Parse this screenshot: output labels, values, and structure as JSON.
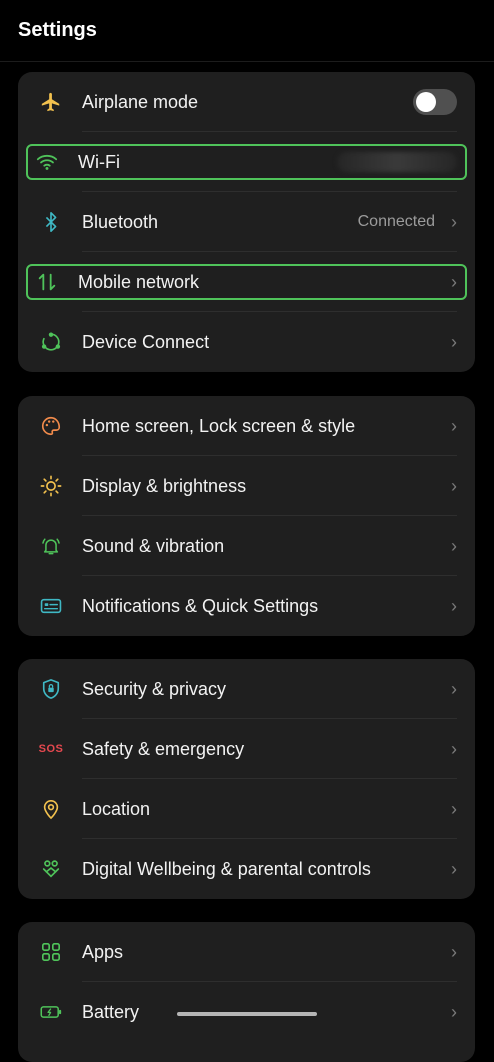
{
  "header": {
    "title": "Settings"
  },
  "colors": {
    "accent_green": "#4fc35a",
    "background": "#000000",
    "card": "#1f1f1f"
  },
  "groups": [
    {
      "items": [
        {
          "label": "Airplane mode",
          "icon": "airplane-icon",
          "toggle": false
        },
        {
          "label": "Wi-Fi",
          "icon": "wifi-icon",
          "highlighted": true
        },
        {
          "label": "Bluetooth",
          "icon": "bluetooth-icon",
          "status": "Connected"
        },
        {
          "label": "Mobile network",
          "icon": "mobile-network-icon",
          "highlighted": true
        },
        {
          "label": "Device Connect",
          "icon": "device-connect-icon"
        }
      ]
    },
    {
      "items": [
        {
          "label": "Home screen, Lock screen & style",
          "icon": "palette-icon"
        },
        {
          "label": "Display & brightness",
          "icon": "sun-icon"
        },
        {
          "label": "Sound & vibration",
          "icon": "bell-icon"
        },
        {
          "label": "Notifications & Quick Settings",
          "icon": "notification-icon"
        }
      ]
    },
    {
      "items": [
        {
          "label": "Security & privacy",
          "icon": "shield-icon"
        },
        {
          "label": "Safety & emergency",
          "icon": "sos-icon",
          "icon_text": "SOS"
        },
        {
          "label": "Location",
          "icon": "location-pin-icon"
        },
        {
          "label": "Digital Wellbeing & parental controls",
          "icon": "wellbeing-icon"
        }
      ]
    },
    {
      "items": [
        {
          "label": "Apps",
          "icon": "apps-grid-icon"
        },
        {
          "label": "Battery",
          "icon": "battery-icon"
        }
      ]
    }
  ]
}
